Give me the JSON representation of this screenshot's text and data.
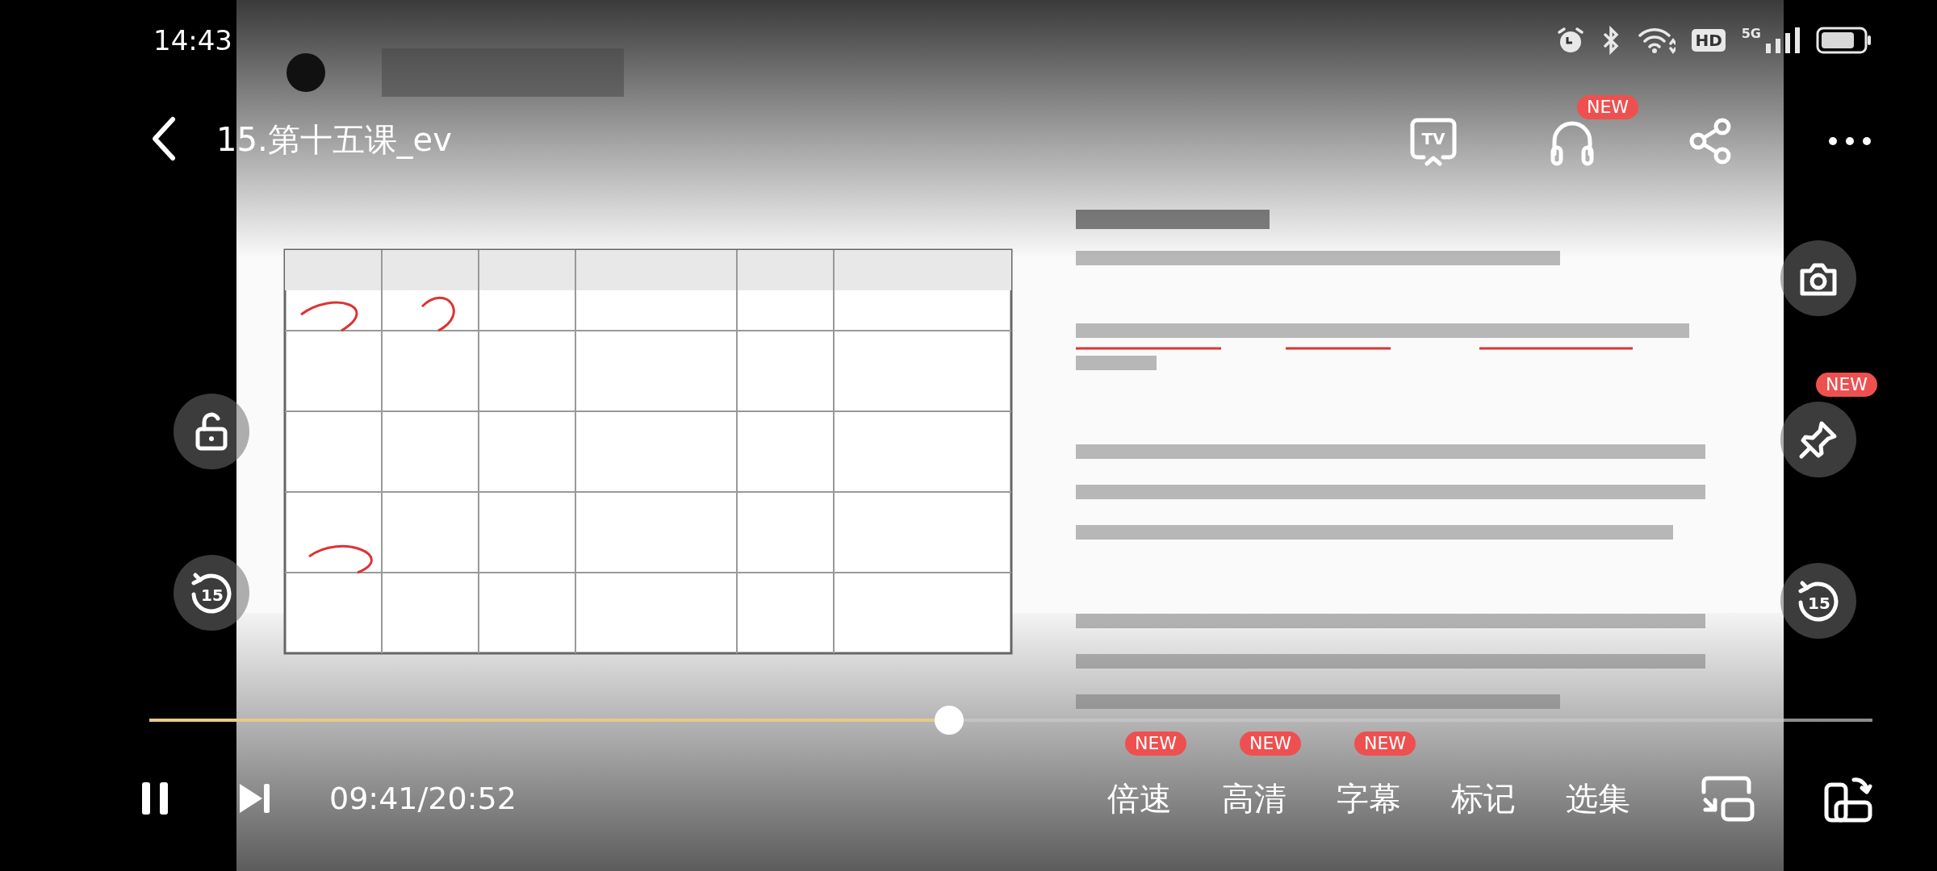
{
  "status_bar": {
    "time": "14:43",
    "hd": "HD",
    "network": "5G"
  },
  "top_bar": {
    "title": "15.第十五课_ev",
    "actions": [
      {
        "kind": "tv",
        "label": "TV"
      },
      {
        "kind": "headphones",
        "badge": "NEW"
      },
      {
        "kind": "share"
      },
      {
        "kind": "more"
      }
    ]
  },
  "side_buttons": {
    "left": [
      {
        "kind": "lock"
      },
      {
        "kind": "replay",
        "label": "15"
      }
    ],
    "right": [
      {
        "kind": "camera"
      },
      {
        "kind": "pin",
        "badge": "NEW"
      },
      {
        "kind": "replay",
        "label": "15"
      }
    ]
  },
  "progress": {
    "level": 0.464
  },
  "controls": {
    "playing": true,
    "time": "09:41/20:52",
    "menu": [
      {
        "label": "倍速",
        "badge": "NEW"
      },
      {
        "label": "高清",
        "badge": "NEW"
      },
      {
        "label": "字幕",
        "badge": "NEW"
      },
      {
        "label": "标记"
      },
      {
        "label": "选集"
      }
    ],
    "actions": [
      {
        "kind": "cast"
      },
      {
        "kind": "rotate"
      }
    ]
  }
}
